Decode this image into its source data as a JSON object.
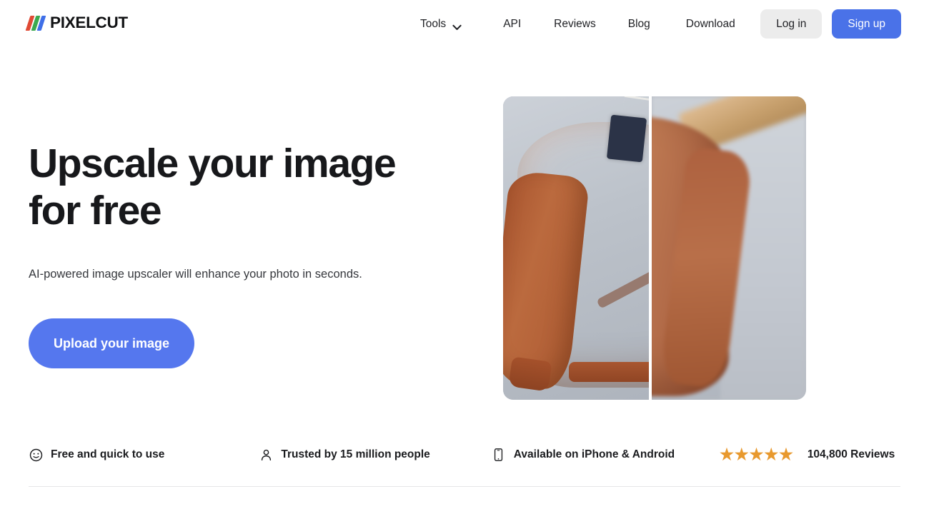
{
  "brand": {
    "name": "PIXELCUT",
    "logo_colors": [
      "#e04a35",
      "#3ba94f",
      "#3f6fe8"
    ]
  },
  "nav": {
    "items": [
      {
        "label": "Tools",
        "has_dropdown": true,
        "icon": "chevron-down-icon"
      },
      {
        "label": "API",
        "has_dropdown": false
      },
      {
        "label": "Reviews",
        "has_dropdown": false
      },
      {
        "label": "Blog",
        "has_dropdown": false
      },
      {
        "label": "Download",
        "has_dropdown": false
      }
    ]
  },
  "auth": {
    "login_label": "Log in",
    "signup_label": "Sign up",
    "signup_color": "#4a72e8",
    "login_bg": "#ececec"
  },
  "hero": {
    "headline": "Upscale your image\nfor free",
    "subhead": "AI-powered image upscaler will enhance your photo in seconds.",
    "cta_label": "Upload your image",
    "cta_color": "#5577ee",
    "image_alt": "Before and after upscaling comparison of an orange bomber jacket on a hanger"
  },
  "features": [
    {
      "icon": "smiley-face-icon",
      "label": "Free and quick to use"
    },
    {
      "icon": "person-icon",
      "label": "Trusted by 15 million people"
    },
    {
      "icon": "mobile-phone-icon",
      "label": "Available on iPhone & Android"
    }
  ],
  "reviews": {
    "stars": 5,
    "star_glyph": "★",
    "star_color": "#e8992e",
    "label": "104,800 Reviews"
  }
}
